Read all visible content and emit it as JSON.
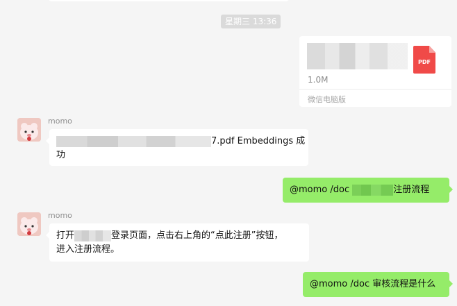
{
  "timestamp": "星期三 13:36",
  "file_card": {
    "size": "1.0M",
    "source": "微信电脑版",
    "icon": "pdf-file-icon",
    "icon_label": "PDF"
  },
  "messages": [
    {
      "sender": "momo",
      "avatar": "pink-mascot-avatar",
      "text_line1": "7.pdf Embeddings 成",
      "text_line2": "功"
    },
    {
      "text_prefix": "@momo /doc ",
      "text_suffix": "注册流程"
    },
    {
      "sender": "momo",
      "avatar": "pink-mascot-avatar",
      "text_line1_prefix": "打开",
      "text_line1_suffix": "登录页面，点击右上角的“点此注册”按钮，",
      "text_line2": "进入注册流程。"
    },
    {
      "text": "@momo /doc 审核流程是什么"
    }
  ],
  "colors": {
    "background": "#f5f5f5",
    "incoming_bubble": "#ffffff",
    "outgoing_bubble": "#95ec69",
    "pdf_icon": "#f04a48"
  }
}
